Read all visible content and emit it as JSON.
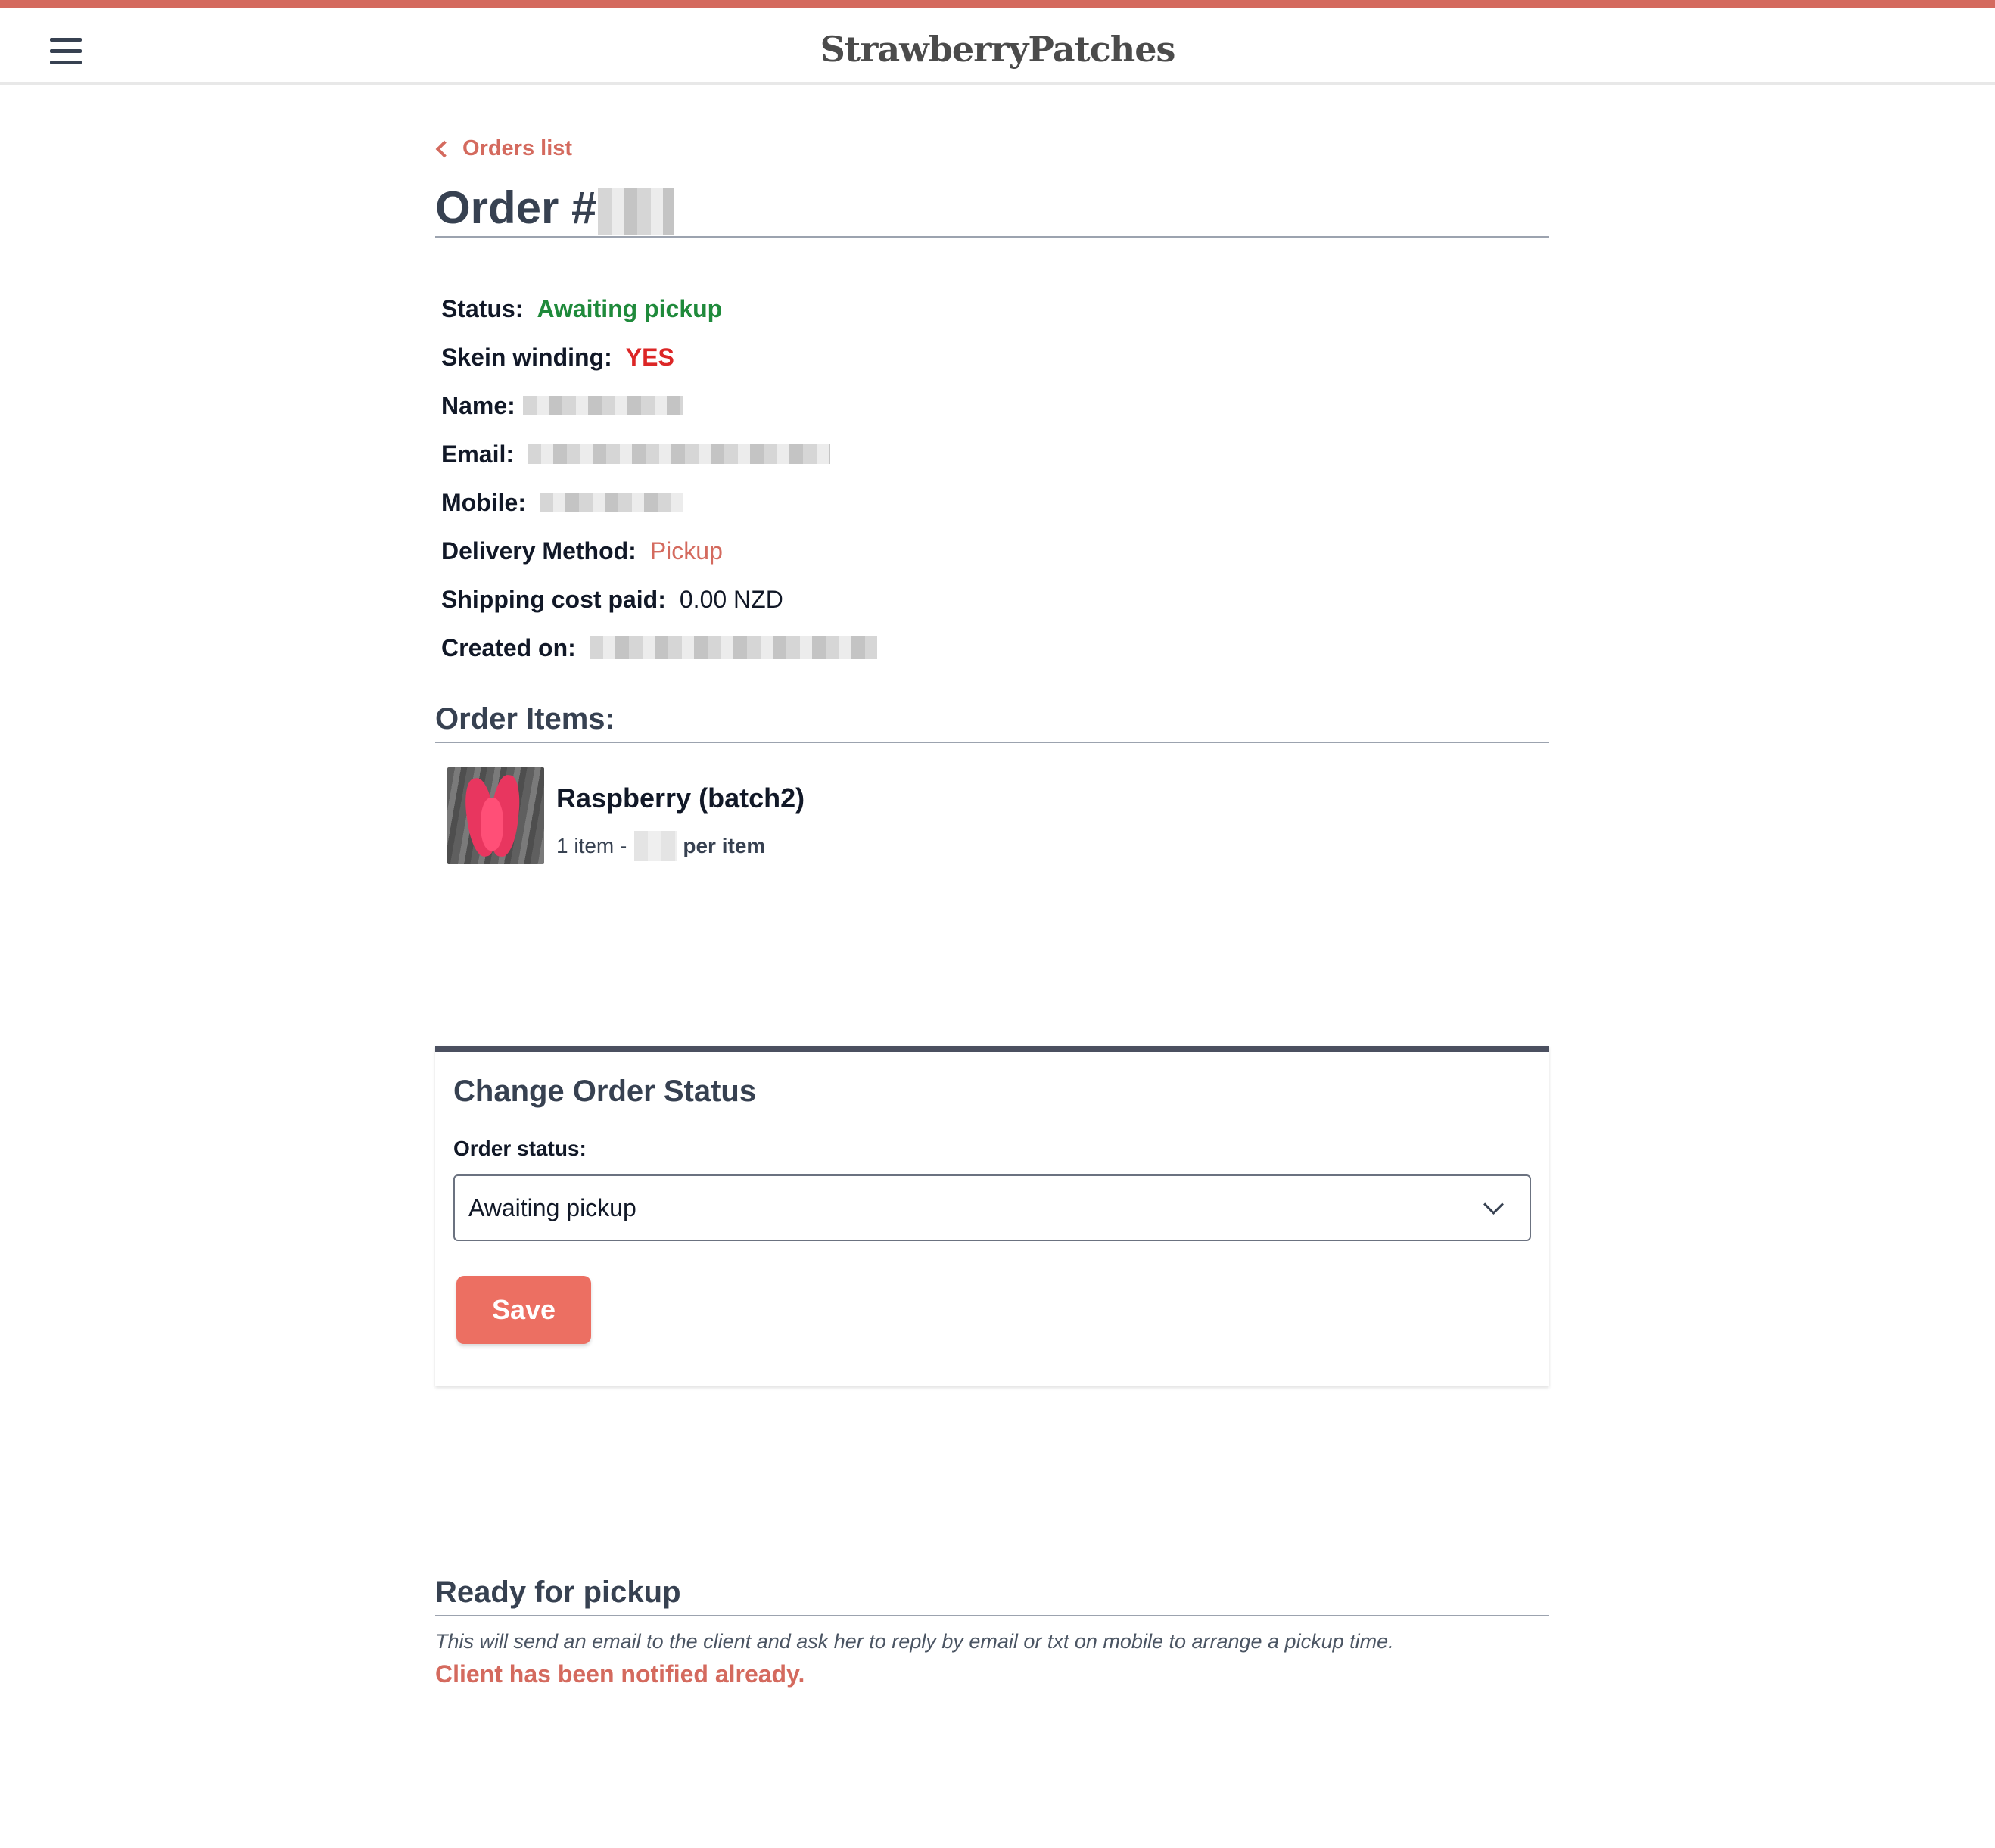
{
  "header": {
    "logo_text": "StrawberryPatches"
  },
  "nav": {
    "back_label": "Orders list"
  },
  "order": {
    "title_prefix": "Order #",
    "fields": {
      "status_label": "Status:",
      "status_value": "Awaiting pickup",
      "skein_label": "Skein winding:",
      "skein_value": "YES",
      "name_label": "Name:",
      "email_label": "Email:",
      "mobile_label": "Mobile:",
      "delivery_label": "Delivery Method:",
      "delivery_value": "Pickup",
      "shipping_label": "Shipping cost paid:",
      "shipping_value": "0.00 NZD",
      "created_label": "Created on:"
    }
  },
  "items_section": {
    "heading": "Order Items:",
    "items": [
      {
        "name": "Raspberry (batch2)",
        "qty_text": "1 item -",
        "per_item_text": "per item"
      }
    ]
  },
  "status_card": {
    "title": "Change Order Status",
    "field_label": "Order status:",
    "selected_value": "Awaiting pickup",
    "save_label": "Save"
  },
  "pickup_section": {
    "heading": "Ready for pickup",
    "note": "This will send an email to the client and ask her to reply by email or txt on mobile to arrange a pickup time.",
    "notified_text": "Client has been notified already."
  },
  "colors": {
    "accent": "#d46a5e",
    "button": "#ec6f62",
    "status_green": "#1f8a3b",
    "alert_red": "#dc2626",
    "card_border": "#4b5060"
  }
}
